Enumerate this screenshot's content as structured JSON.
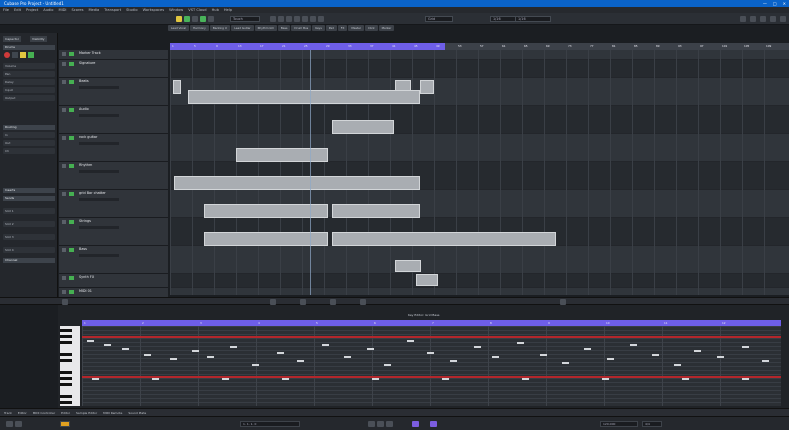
{
  "window": {
    "title": "Cubase Pro Project - Untitled1"
  },
  "menu": [
    "File",
    "Edit",
    "Project",
    "Audio",
    "MIDI",
    "Scores",
    "Media",
    "Transport",
    "Studio",
    "Workspaces",
    "Window",
    "VST Cloud",
    "Hub",
    "Help"
  ],
  "toolbar": {
    "buttons": 9
  },
  "presets": [
    "Lead Vocal",
    "Harmony",
    "Backing V.",
    "Lead Guitar",
    "Rhythm Gtr",
    "Bass",
    "Drum Bus",
    "Keys",
    "Pad",
    "FX",
    "Master",
    "Click",
    "Marker"
  ],
  "left": {
    "tabs": [
      "Inspector",
      "Visibility",
      "Zones",
      "Racks"
    ],
    "sections": [
      "Drums",
      "Routing",
      "Inserts",
      "Sends",
      "Channel"
    ]
  },
  "tracks": [
    {
      "name": "Marker Track"
    },
    {
      "name": "Signature"
    },
    {
      "name": "Beats"
    },
    {
      "name": "Audio"
    },
    {
      "name": "rock guitar"
    },
    {
      "name": "Rhythm"
    },
    {
      "name": "grid Bar chatter"
    },
    {
      "name": "Strings"
    },
    {
      "name": "Bass"
    },
    {
      "name": "Synth FX"
    },
    {
      "name": "MIDI 01"
    }
  ],
  "ruler": {
    "bars": [
      "1",
      "5",
      "9",
      "13",
      "17",
      "21",
      "25",
      "29",
      "33",
      "37",
      "41",
      "45",
      "49",
      "53",
      "57",
      "61",
      "65",
      "69",
      "73",
      "77",
      "81",
      "85",
      "89",
      "93",
      "97",
      "101",
      "105",
      "109"
    ]
  },
  "editor": {
    "title": "Key Editor: Grid Bass",
    "bars": [
      "1",
      "2",
      "3",
      "4",
      "5",
      "6",
      "7",
      "8",
      "9",
      "10",
      "11",
      "12"
    ]
  },
  "bottombar": [
    "Track",
    "Editor",
    "MIDI Controller",
    "Editor",
    "Sample Editor",
    "MIDI Remote",
    "Sound Plate"
  ],
  "transport": {
    "position": "1. 1. 1. 0",
    "tempo": "120.000",
    "signature": "4/4"
  }
}
